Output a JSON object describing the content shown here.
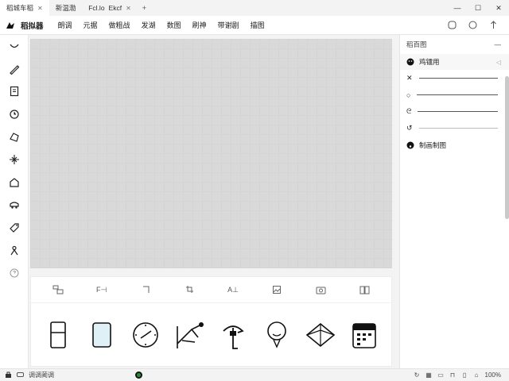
{
  "tabs": [
    {
      "label": "稻城车稻",
      "active": true
    },
    {
      "label": "新温渤",
      "active": false
    },
    {
      "label": "Fcl.lo",
      "active": false
    },
    {
      "label": "Ekcf",
      "active": false
    }
  ],
  "menubar": {
    "brand": "稻拟器",
    "items": [
      "朗调",
      "元据",
      "做粗战",
      "发湖",
      "数图",
      "刷神",
      "带谢剧",
      "描图"
    ]
  },
  "library": {
    "tabs": [
      "",
      "F⊣",
      "",
      "",
      "A⊥",
      "",
      "",
      ""
    ]
  },
  "right_panel": {
    "header": "稻百图",
    "layer_label": "鸡镭用",
    "footer_label": "制画制图"
  },
  "statusbar": {
    "left_text": "调调蔺调",
    "right_text": "100%"
  },
  "colors": {
    "canvas": "#d9d9d9",
    "accent_status": "#2a8a3a",
    "tile_fill": "#dff0f7"
  }
}
